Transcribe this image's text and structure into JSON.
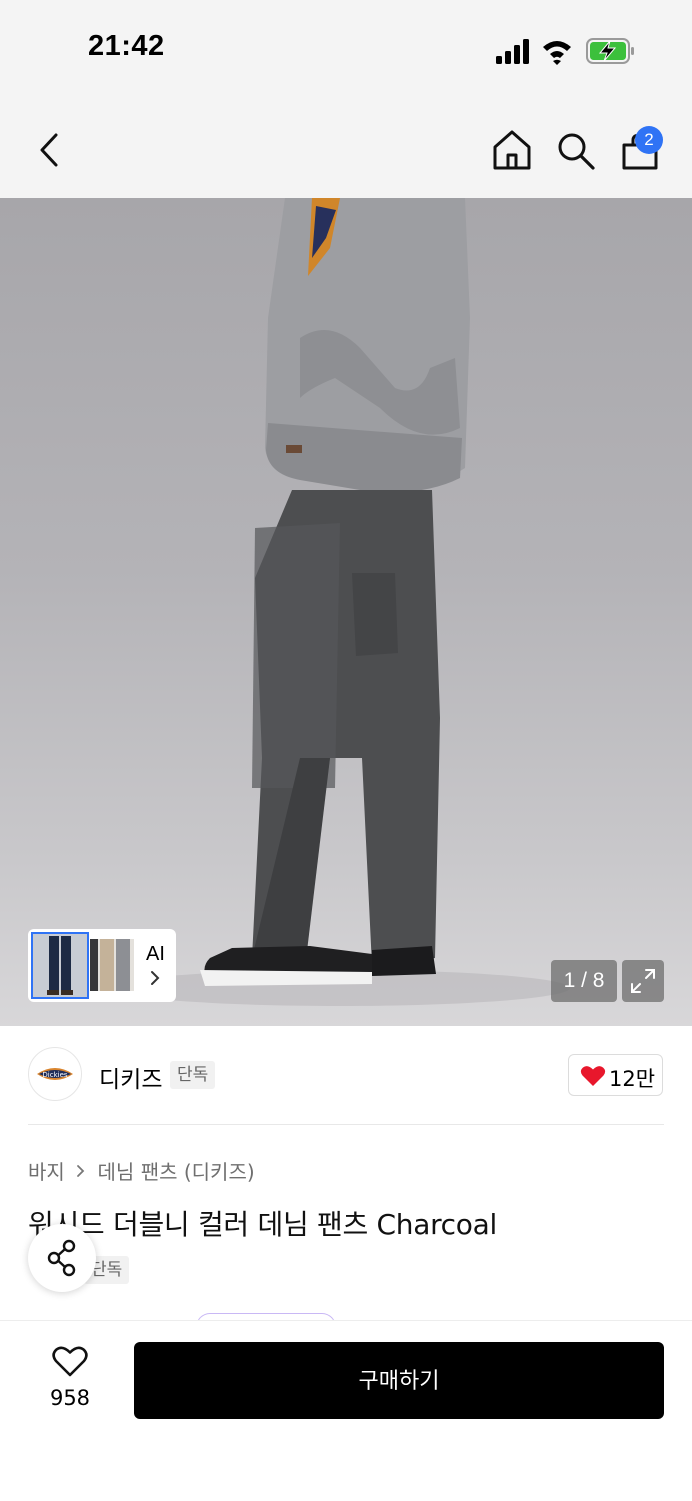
{
  "status_bar": {
    "time": "21:42"
  },
  "nav": {
    "cart_count": "2"
  },
  "gallery": {
    "page_counter": "1 / 8",
    "ai_label": "AI",
    "background_color": "#b4b3b7"
  },
  "brand": {
    "name": "디키즈",
    "badge": "단독",
    "logo_text": "Dickies",
    "like_count": "12만"
  },
  "product": {
    "breadcrumb": [
      "바지",
      "데님 팬츠 (디키즈)"
    ],
    "title": "워시드 더블니 컬러 데님 팬츠 Charcoal",
    "tag": "단독"
  },
  "bottom_bar": {
    "wishlist_count": "958",
    "buy_label": "구매하기"
  },
  "colors": {
    "accent_blue": "#2f73f5",
    "heart_red": "#e8172c",
    "buy_button": "#000000"
  }
}
